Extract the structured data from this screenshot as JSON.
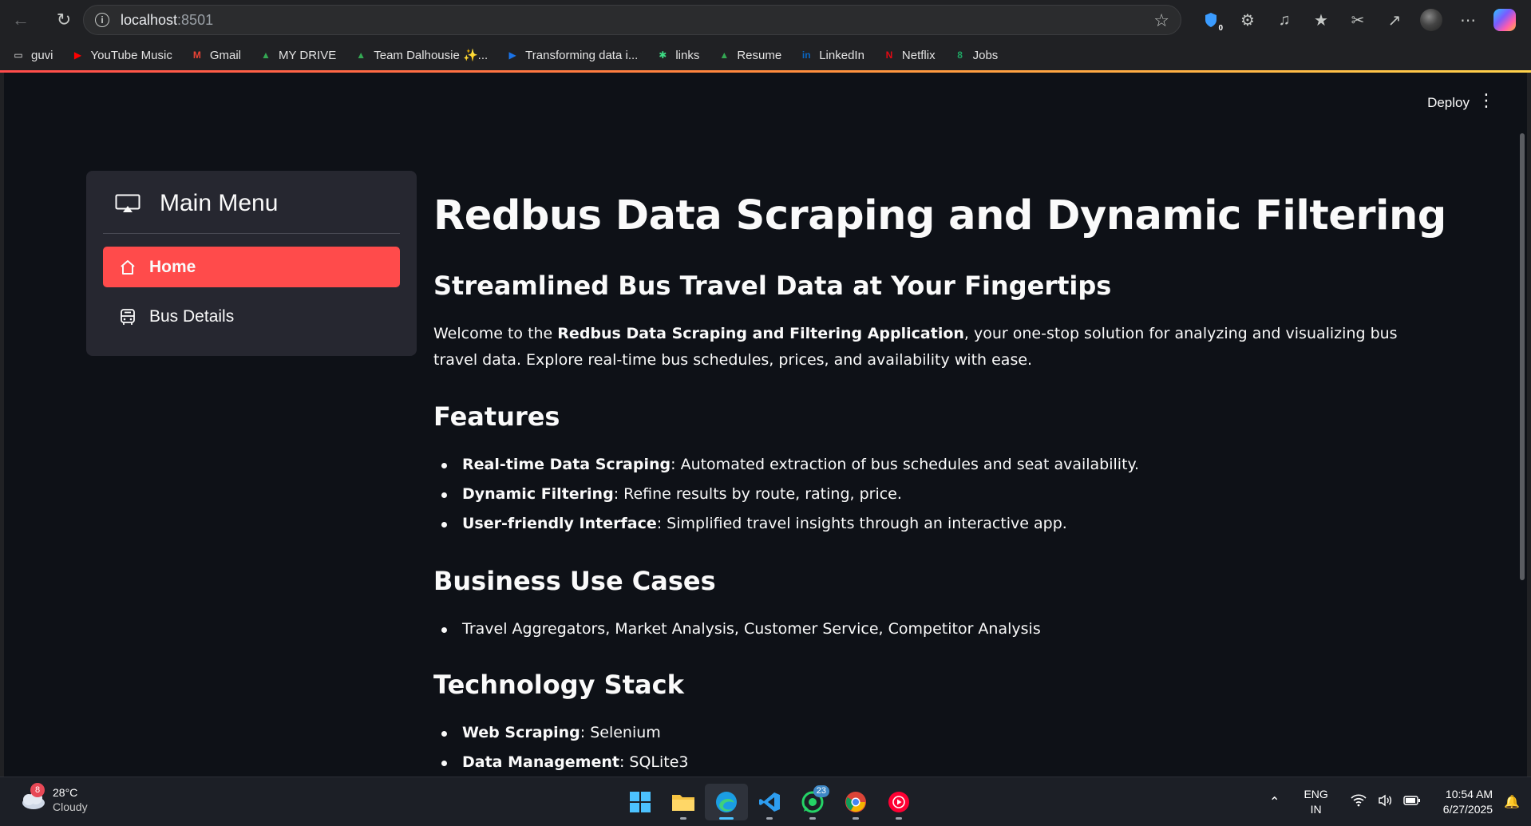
{
  "browser": {
    "url_host": "localhost",
    "url_port": ":8501",
    "toolbar_badge": "0",
    "bookmarks": [
      {
        "label": "guvi",
        "icon": "folder-icon",
        "color": "#e3e3e3"
      },
      {
        "label": "YouTube Music",
        "icon": "youtube-music-icon",
        "color": "#ff0000"
      },
      {
        "label": "Gmail",
        "icon": "gmail-icon",
        "color": "#ea4335"
      },
      {
        "label": "MY DRIVE",
        "icon": "google-drive-icon",
        "color": "#34a853"
      },
      {
        "label": "Team Dalhousie ✨...",
        "icon": "google-drive-icon",
        "color": "#34a853"
      },
      {
        "label": "Transforming data i...",
        "icon": "video-icon",
        "color": "#1a73e8"
      },
      {
        "label": "links",
        "icon": "asterisk-icon",
        "color": "#3ddc84"
      },
      {
        "label": "Resume",
        "icon": "google-drive-icon",
        "color": "#34a853"
      },
      {
        "label": "LinkedIn",
        "icon": "linkedin-icon",
        "color": "#0a66c2"
      },
      {
        "label": "Netflix",
        "icon": "netflix-icon",
        "color": "#e50914"
      },
      {
        "label": "Jobs",
        "icon": "jobs-icon",
        "color": "#1fa463"
      }
    ]
  },
  "app": {
    "deploy_label": "Deploy",
    "menu": {
      "title": "Main Menu",
      "items": [
        {
          "label": "Home",
          "icon": "house-icon",
          "active": true
        },
        {
          "label": "Bus Details",
          "icon": "bus-icon",
          "active": false
        }
      ],
      "accent_color": "#ff4b4b"
    },
    "title": "Redbus Data Scraping and Dynamic Filtering",
    "subtitle": "Streamlined Bus Travel Data at Your Fingertips",
    "intro": {
      "prefix": "Welcome to the ",
      "bold": "Redbus Data Scraping and Filtering Application",
      "suffix": ", your one-stop solution for analyzing and visualizing bus travel data. Explore real-time bus schedules, prices, and availability with ease."
    },
    "features": {
      "heading": "Features",
      "items": [
        {
          "bold": "Real-time Data Scraping",
          "text": ": Automated extraction of bus schedules and seat availability."
        },
        {
          "bold": "Dynamic Filtering",
          "text": ": Refine results by route, rating, price."
        },
        {
          "bold": "User-friendly Interface",
          "text": ": Simplified travel insights through an interactive app."
        }
      ]
    },
    "use_cases": {
      "heading": "Business Use Cases",
      "items": [
        "Travel Aggregators, Market Analysis, Customer Service, Competitor Analysis"
      ]
    },
    "tech_stack": {
      "heading": "Technology Stack",
      "items": [
        {
          "bold": "Web Scraping",
          "text": ": Selenium"
        },
        {
          "bold": "Data Management",
          "text": ": SQLite3"
        }
      ]
    }
  },
  "taskbar": {
    "weather": {
      "badge": "8",
      "temp": "28°C",
      "condition": "Cloudy"
    },
    "whatsapp_count": "23",
    "lang_top": "ENG",
    "lang_bottom": "IN",
    "time": "10:54 AM",
    "date": "6/27/2025"
  }
}
